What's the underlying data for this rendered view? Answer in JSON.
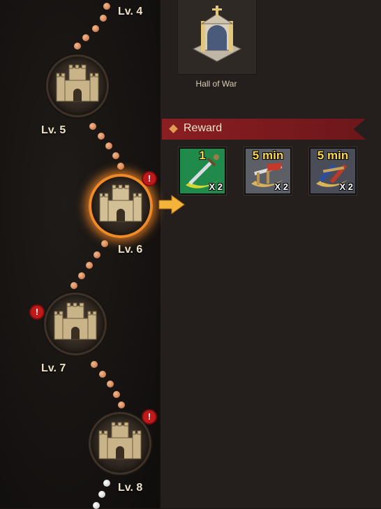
{
  "building": {
    "name": "Hall of War"
  },
  "reward": {
    "title": "Reward",
    "items": [
      {
        "icon": "sword-speedup-icon",
        "amount": "1",
        "quantity": "X 2",
        "bg": "#1f8a4a"
      },
      {
        "icon": "build-speedup-icon",
        "amount": "5 min",
        "quantity": "X 2",
        "bg": "#5d5f66"
      },
      {
        "icon": "train-speedup-icon",
        "amount": "5 min",
        "quantity": "X 2",
        "bg": "#4a4d57"
      }
    ]
  },
  "levels": [
    {
      "label": "Lv. 4",
      "state": "reached"
    },
    {
      "label": "Lv. 5",
      "state": "reached"
    },
    {
      "label": "Lv. 6",
      "state": "selected",
      "alert": "!"
    },
    {
      "label": "Lv. 7",
      "state": "locked",
      "alert": "!"
    },
    {
      "label": "Lv. 8",
      "state": "locked",
      "alert": "!"
    }
  ],
  "colors": {
    "accent": "#f08a28",
    "banner": "#8a1e22",
    "alert": "#c0191a"
  }
}
